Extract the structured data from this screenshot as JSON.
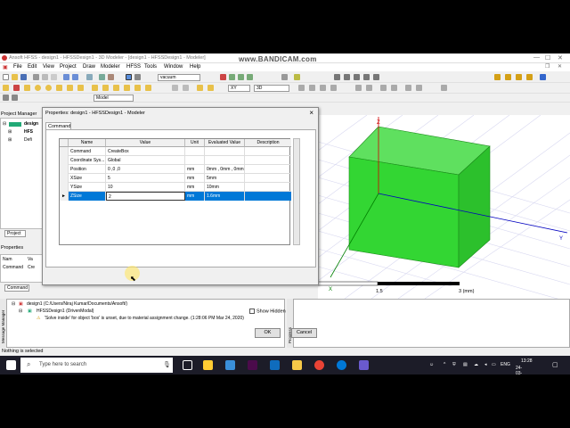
{
  "app": {
    "title": "Ansoft HFSS - design1 - HFSSDesign1 - 3D Modeler - [design1 - HFSSDesign1 - Modeler]",
    "watermark": "www.BANDICAM.com",
    "menu": [
      "File",
      "Edit",
      "View",
      "Project",
      "Draw",
      "Modeler",
      "HFSS",
      "Tools",
      "Window",
      "Help"
    ]
  },
  "toolbar": {
    "combo_material": "vacuum",
    "combo_model": "Model",
    "plane": "XY",
    "mode": "3D"
  },
  "project_manager": {
    "title": "Project Manager",
    "items": [
      "design",
      "HFS",
      "Defi"
    ],
    "tab": "Project"
  },
  "properties_panel": {
    "title": "Properties",
    "headers": [
      "Nam",
      "Va"
    ],
    "row": [
      "Command",
      "Cre"
    ],
    "tab": "Command"
  },
  "dialog": {
    "title": "Properties: design1 - HFSSDesign1 - Modeler",
    "tab": "Command",
    "columns": [
      "Name",
      "Value",
      "Unit",
      "Evaluated Value",
      "Description"
    ],
    "rows": [
      {
        "name": "Command",
        "value": "CreateBox",
        "unit": "",
        "evaluated": "",
        "description": ""
      },
      {
        "name": "Coordinate Sys...",
        "value": "Global",
        "unit": "",
        "evaluated": "",
        "description": ""
      },
      {
        "name": "Position",
        "value": "0 ,0 ,0",
        "unit": "mm",
        "evaluated": "0mm , 0mm , 0mm",
        "description": ""
      },
      {
        "name": "XSize",
        "value": "5",
        "unit": "mm",
        "evaluated": "5mm",
        "description": ""
      },
      {
        "name": "YSize",
        "value": "10",
        "unit": "mm",
        "evaluated": "10mm",
        "description": ""
      },
      {
        "name": "ZSize",
        "value": "2",
        "unit": "mm",
        "evaluated": "1.6mm",
        "description": ""
      }
    ],
    "show_hidden": "Show Hidden",
    "ok": "OK",
    "cancel": "Cancel"
  },
  "viewport": {
    "axis_z": "Z",
    "axis_x": "X",
    "axis_y": "Y",
    "scale": [
      "0",
      "1.5",
      "3 (mm)"
    ],
    "box_color": "#33d633"
  },
  "messages": {
    "project": "design1 (C:/Users/Niraj Kumar/Documents/Ansoft/)",
    "design": "HFSSDesign1 (DrivenModal)",
    "warning": "'Solve inside' for object 'box' is unset, due to material assignment change. (1:28:06 PM  Mar 24, 2020)",
    "label": "Message Manager",
    "progress_label": "Progress"
  },
  "status": "Nothing is selected",
  "taskbar": {
    "search": "Type here to search",
    "lang": "ENG",
    "time": "13:28",
    "date": "24-03-2020"
  }
}
